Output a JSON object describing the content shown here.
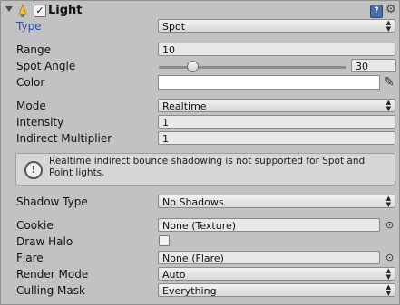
{
  "header": {
    "title": "Light",
    "enabled_glyph": "✓",
    "icons": [
      "foldout-arrow-icon",
      "light-bulb-icon",
      "reference-book-icon",
      "gear-icon"
    ]
  },
  "fields": {
    "type": {
      "label": "Type",
      "value": "Spot"
    },
    "range": {
      "label": "Range",
      "value": "10"
    },
    "spot_angle": {
      "label": "Spot Angle",
      "value": "30",
      "slider_fraction": 0.18
    },
    "color": {
      "label": "Color",
      "value": "#ffffff"
    },
    "mode": {
      "label": "Mode",
      "value": "Realtime"
    },
    "intensity": {
      "label": "Intensity",
      "value": "1"
    },
    "indirect_multiplier": {
      "label": "Indirect Multiplier",
      "value": "1"
    },
    "help": {
      "text": "Realtime indirect bounce shadowing is not supported for Spot and Point lights."
    },
    "shadow_type": {
      "label": "Shadow Type",
      "value": "No Shadows"
    },
    "cookie": {
      "label": "Cookie",
      "value": "None (Texture)"
    },
    "draw_halo": {
      "label": "Draw Halo",
      "checked": false
    },
    "flare": {
      "label": "Flare",
      "value": "None (Flare)"
    },
    "render_mode": {
      "label": "Render Mode",
      "value": "Auto"
    },
    "culling_mask": {
      "label": "Culling Mask",
      "value": "Everything"
    }
  },
  "colors": {
    "panel_bg": "#c2c2c2",
    "label_highlight": "#2a4fb0"
  }
}
